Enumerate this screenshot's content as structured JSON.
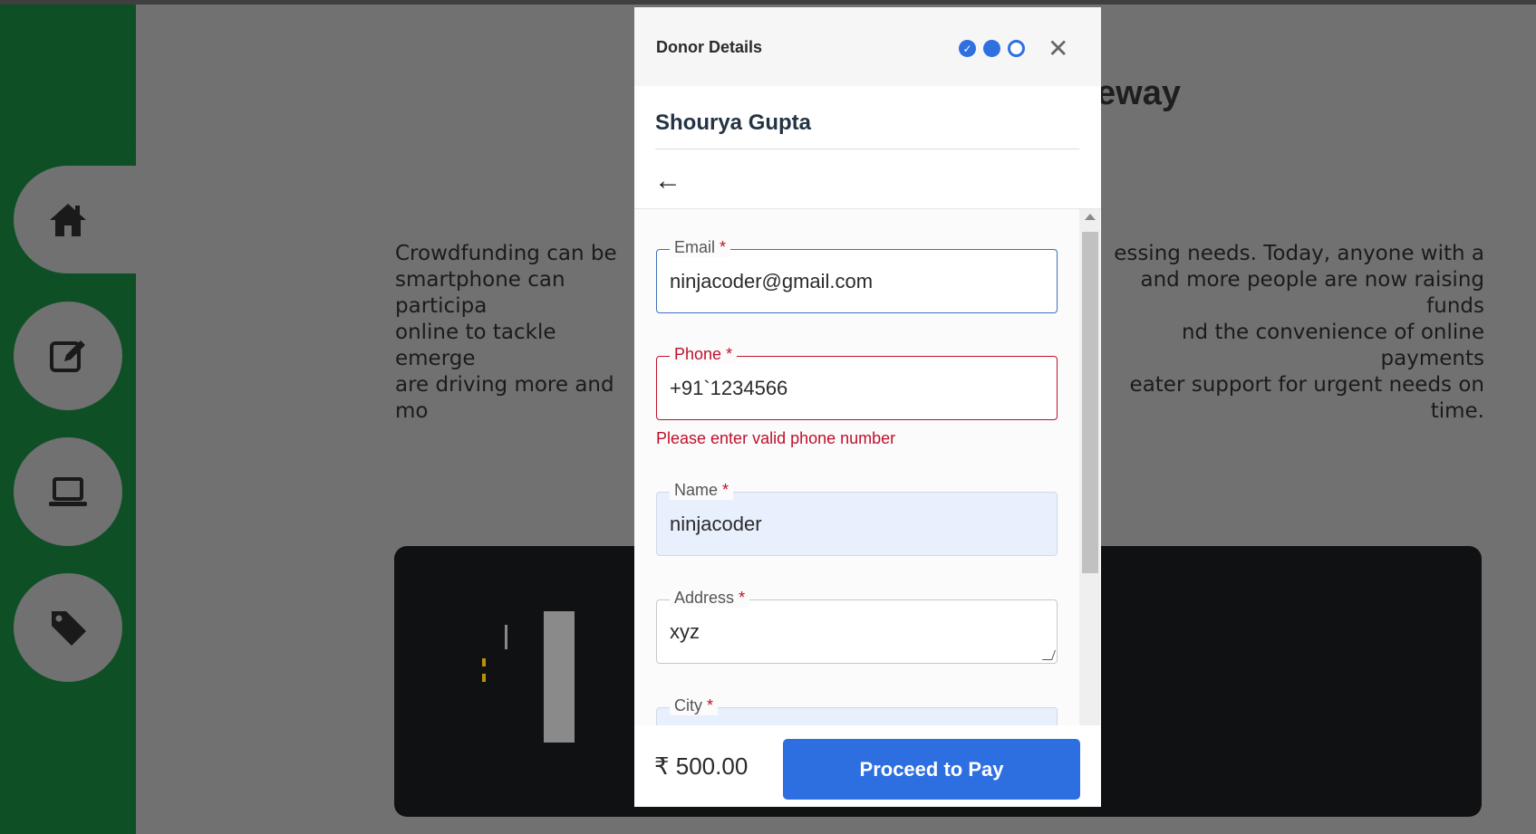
{
  "background": {
    "title_fragment": "eway",
    "paragraph_left": "Crowdfunding can be\nsmartphone can participa\nonline to tackle emerge\nare driving more and mo",
    "paragraph_right": "essing needs. Today, anyone with a\nand more people are now raising funds\nnd the convenience of online payments\neater support for urgent needs on time."
  },
  "sidebar": {
    "items": [
      {
        "icon": "home-icon"
      },
      {
        "icon": "edit-icon"
      },
      {
        "icon": "laptop-icon"
      },
      {
        "icon": "tag-icon"
      }
    ]
  },
  "modal": {
    "title": "Donor Details",
    "steps": [
      "done",
      "active",
      "todo"
    ],
    "close_label": "✕",
    "donor_name": "Shourya Gupta",
    "back_label": "←",
    "fields": {
      "email": {
        "label": "Email",
        "value": "ninjacoder@gmail.com"
      },
      "phone": {
        "label": "Phone",
        "value": "+91`1234566",
        "error": "Please enter valid phone number"
      },
      "name": {
        "label": "Name",
        "value": "ninjacoder"
      },
      "address": {
        "label": "Address",
        "value": "xyz"
      },
      "city": {
        "label": "City",
        "value": ""
      }
    },
    "required_mark": "*",
    "amount": "₹ 500.00",
    "pay_button": "Proceed to Pay"
  }
}
